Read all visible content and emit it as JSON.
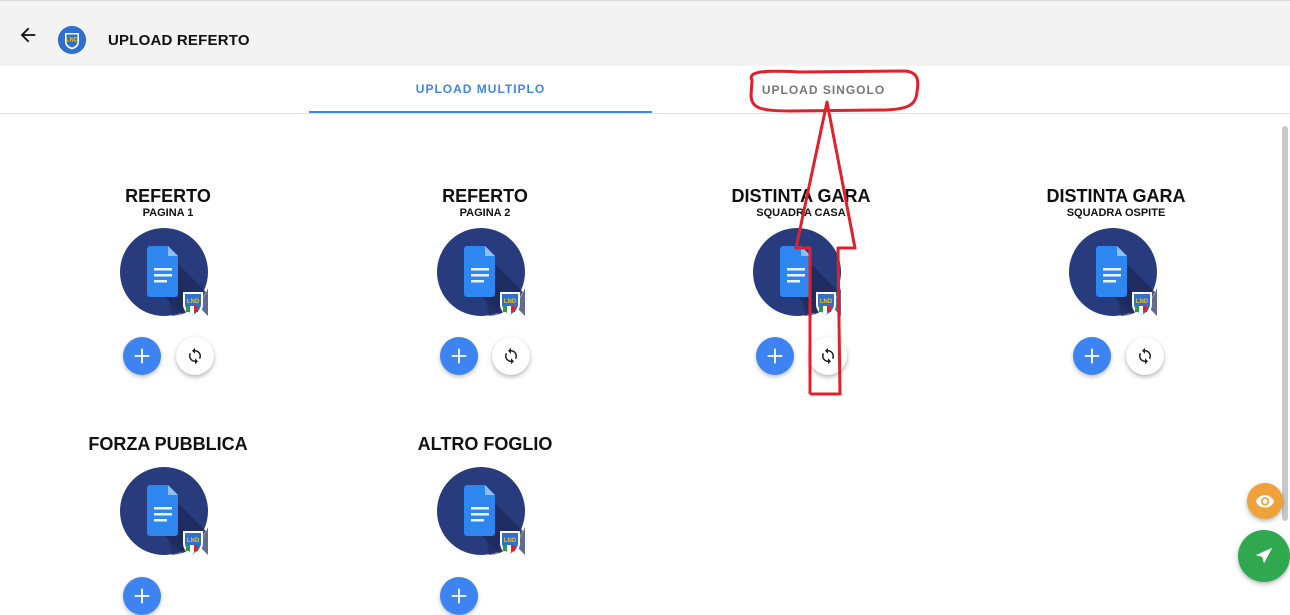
{
  "header": {
    "title": "UPLOAD REFERTO",
    "back_icon": "arrow-left-icon",
    "logo_text": "LND"
  },
  "tabs": [
    {
      "label": "UPLOAD MULTIPLO",
      "active": true
    },
    {
      "label": "UPLOAD SINGOLO",
      "active": false
    }
  ],
  "cards": [
    {
      "title": "REFERTO",
      "subtitle": "PAGINA 1"
    },
    {
      "title": "REFERTO",
      "subtitle": "PAGINA 2"
    },
    {
      "title": "DISTINTA GARA",
      "subtitle": "SQUADRA CASA"
    },
    {
      "title": "DISTINTA GARA",
      "subtitle": "SQUADRA OSPITE"
    },
    {
      "title": "FORZA PUBBLICA",
      "subtitle": ""
    },
    {
      "title": "ALTRO FOGLIO",
      "subtitle": ""
    }
  ],
  "badge_text": "LND",
  "colors": {
    "accent": "#3f86ea",
    "add_button": "#3d83f1",
    "doc_circle": "#283b7c",
    "eye_fab": "#f0a13a",
    "send_fab": "#2fa84f",
    "annotation": "#e0202a"
  }
}
